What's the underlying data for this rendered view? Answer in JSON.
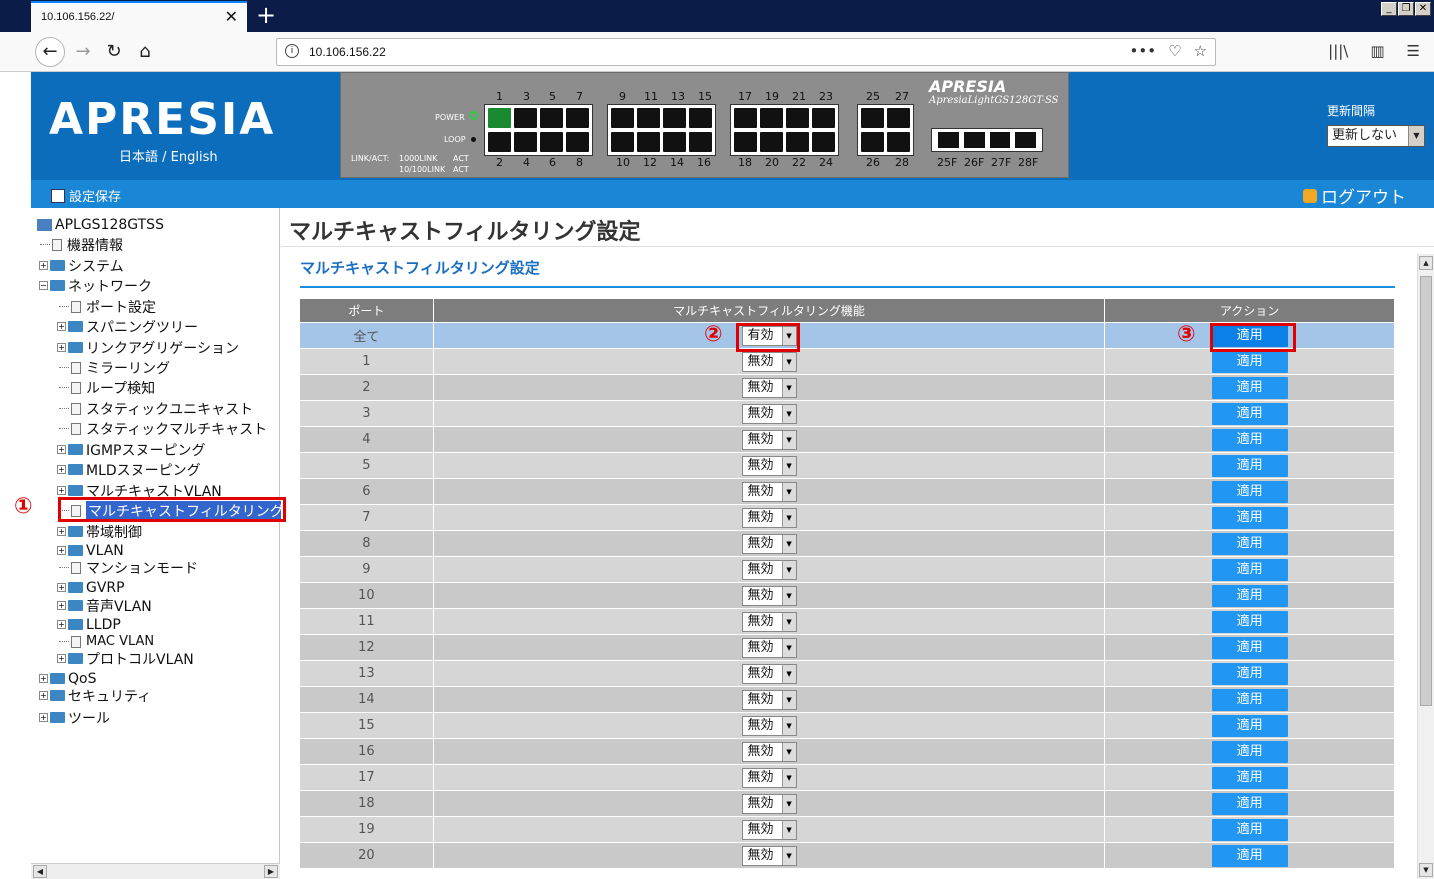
{
  "browser": {
    "tab_title": "10.106.156.22/",
    "url": "10.106.156.22",
    "url_actions": [
      "•••",
      "♡",
      "☆"
    ]
  },
  "header": {
    "logo": "APRESIA",
    "lang": "日本語 / English",
    "brand_small": "APRESIA",
    "model_small": "ApresiaLightGS128GT-SS",
    "power_label": "POWER",
    "loop_label": "LOOP",
    "linkact_label": "LINK/ACT:",
    "link1000_label": "1000LINK",
    "link100_label": "10/100LINK",
    "act_label": "ACT",
    "top_ports": [
      "1",
      "3",
      "5",
      "7",
      "9",
      "11",
      "13",
      "15",
      "17",
      "19",
      "21",
      "23",
      "25",
      "27"
    ],
    "bottom_ports": [
      "2",
      "4",
      "6",
      "8",
      "10",
      "12",
      "14",
      "16",
      "18",
      "20",
      "22",
      "24",
      "26",
      "28"
    ],
    "sfp_ports": [
      "25F",
      "26F",
      "27F",
      "28F"
    ],
    "refresh_label": "更新間隔",
    "refresh_value": "更新しない"
  },
  "toolbar": {
    "save": "設定保存",
    "logout": "ログアウト"
  },
  "sidebar": {
    "root": "APLGS128GTSS",
    "items": [
      {
        "label": "機器情報"
      },
      {
        "label": "システム"
      },
      {
        "label": "ネットワーク"
      },
      {
        "label": "ポート設定"
      },
      {
        "label": "スパニングツリー"
      },
      {
        "label": "リンクアグリゲーション"
      },
      {
        "label": "ミラーリング"
      },
      {
        "label": "ループ検知"
      },
      {
        "label": "スタティックユニキャスト"
      },
      {
        "label": "スタティックマルチキャスト"
      },
      {
        "label": "IGMPスヌーピング"
      },
      {
        "label": "MLDスヌーピング"
      },
      {
        "label": "マルチキャストVLAN"
      },
      {
        "label": "マルチキャストフィルタリング"
      },
      {
        "label": "帯域制御"
      },
      {
        "label": "VLAN"
      },
      {
        "label": "マンションモード"
      },
      {
        "label": "GVRP"
      },
      {
        "label": "音声VLAN"
      },
      {
        "label": "LLDP"
      },
      {
        "label": "MAC VLAN"
      },
      {
        "label": "プロトコルVLAN"
      },
      {
        "label": "QoS"
      },
      {
        "label": "セキュリティ"
      },
      {
        "label": "ツール"
      }
    ]
  },
  "main": {
    "page_title": "マルチキャストフィルタリング設定",
    "section_title": "マルチキャストフィルタリング設定",
    "columns": [
      "ポート",
      "マルチキャストフィルタリング機能",
      "アクション"
    ],
    "rows": [
      {
        "port": "全て",
        "value": "有効",
        "action": "適用"
      },
      {
        "port": "1",
        "value": "無効",
        "action": "適用"
      },
      {
        "port": "2",
        "value": "無効",
        "action": "適用"
      },
      {
        "port": "3",
        "value": "無効",
        "action": "適用"
      },
      {
        "port": "4",
        "value": "無効",
        "action": "適用"
      },
      {
        "port": "5",
        "value": "無効",
        "action": "適用"
      },
      {
        "port": "6",
        "value": "無効",
        "action": "適用"
      },
      {
        "port": "7",
        "value": "無効",
        "action": "適用"
      },
      {
        "port": "8",
        "value": "無効",
        "action": "適用"
      },
      {
        "port": "9",
        "value": "無効",
        "action": "適用"
      },
      {
        "port": "10",
        "value": "無効",
        "action": "適用"
      },
      {
        "port": "11",
        "value": "無効",
        "action": "適用"
      },
      {
        "port": "12",
        "value": "無効",
        "action": "適用"
      },
      {
        "port": "13",
        "value": "無効",
        "action": "適用"
      },
      {
        "port": "14",
        "value": "無効",
        "action": "適用"
      },
      {
        "port": "15",
        "value": "無効",
        "action": "適用"
      },
      {
        "port": "16",
        "value": "無効",
        "action": "適用"
      },
      {
        "port": "17",
        "value": "無効",
        "action": "適用"
      },
      {
        "port": "18",
        "value": "無効",
        "action": "適用"
      },
      {
        "port": "19",
        "value": "無効",
        "action": "適用"
      },
      {
        "port": "20",
        "value": "無効",
        "action": "適用"
      }
    ]
  },
  "callouts": [
    "①",
    "②",
    "③"
  ],
  "colors": {
    "header_blue": "#0d6dbd",
    "toolbar_blue": "#1a86d6",
    "apply_button": "#2196f3",
    "highlight_red": "#e00000",
    "selected_row": "#a4c5e8"
  }
}
